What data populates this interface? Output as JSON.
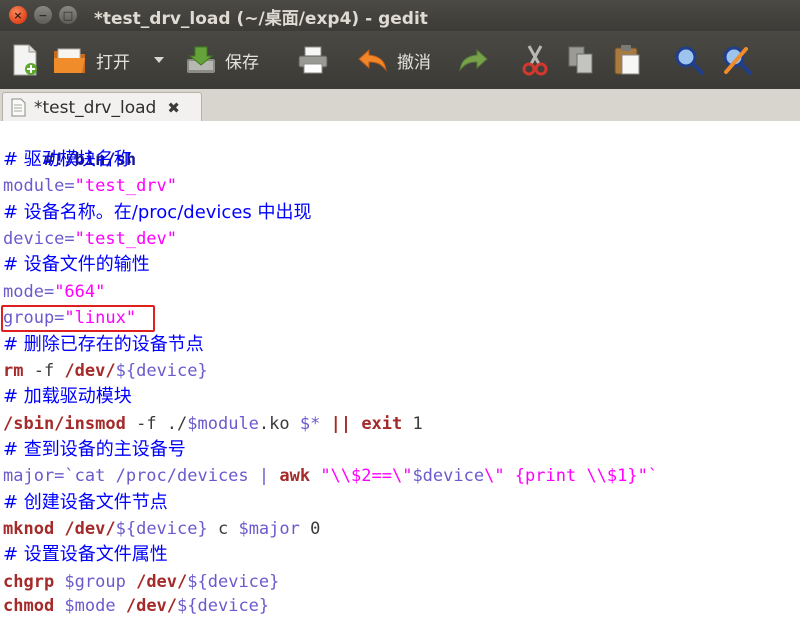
{
  "window": {
    "title": "*test_drv_load (~/桌面/exp4) - gedit",
    "controls": {
      "close": "×",
      "minimize": "−",
      "maximize": "□"
    }
  },
  "toolbar": {
    "open_label": "打开",
    "save_label": "保存",
    "undo_label": "撤消",
    "icons": [
      "new-document-icon",
      "open-folder-icon",
      "dropdown-arrow-icon",
      "save-icon",
      "print-icon",
      "undo-icon",
      "redo-icon",
      "cut-icon",
      "copy-icon",
      "paste-icon",
      "search-icon",
      "replace-icon"
    ]
  },
  "tab": {
    "title": "*test_drv_load",
    "close": "✖"
  },
  "colors": {
    "titlebar": "#3c3b37",
    "comment": "#0000ff",
    "string": "#ff00ff",
    "variable": "#6a5acd",
    "keyword": "#a52a2a",
    "highlight_box": "#e02020"
  },
  "code": {
    "l1": "#!/bin/sh",
    "l2": "# 驱动模块名称",
    "l3a": "module=",
    "l3b": "\"test_drv\"",
    "l4": "# 设备名称。在/proc/devices 中出现",
    "l5a": "device=",
    "l5b": "\"test_dev\"",
    "l6": "# 设备文件的输性",
    "l7a": "mode=",
    "l7b": "\"664\"",
    "l8a": "group=",
    "l8b": "\"linux\"",
    "l9": "# 删除已存在的设备节点",
    "l10a": "rm",
    "l10b": " -f ",
    "l10c": "/dev/",
    "l10d": "${device}",
    "l11": "# 加载驱动模块",
    "l12a": "/sbin/",
    "l12b": "insmod",
    "l12c": " -f ./",
    "l12d": "$module",
    "l12e": ".ko ",
    "l12f": "$*",
    "l12g": " || ",
    "l12h": "exit",
    "l12i": " 1",
    "l13": "# 查到设备的主设备号",
    "l14a": "major=",
    "l14b": "`cat /proc/devices | ",
    "l14c": "awk",
    "l14d": " \"\\\\$2==\\\"",
    "l14e": "$device",
    "l14f": "\\\" {print \\\\$1}\"`",
    "l15": "# 创建设备文件节点",
    "l16a": "mknod",
    "l16b": " /dev/",
    "l16c": "${device}",
    "l16d": " c ",
    "l16e": "$major",
    "l16f": " 0",
    "l17": "# 设置设备文件属性",
    "l18a": "chgrp",
    "l18b": " $group",
    "l18c": " /dev/",
    "l18d": "${device}",
    "l19a": "chmod",
    "l19b": " $mode",
    "l19c": " /dev/",
    "l19d": "${device}"
  }
}
